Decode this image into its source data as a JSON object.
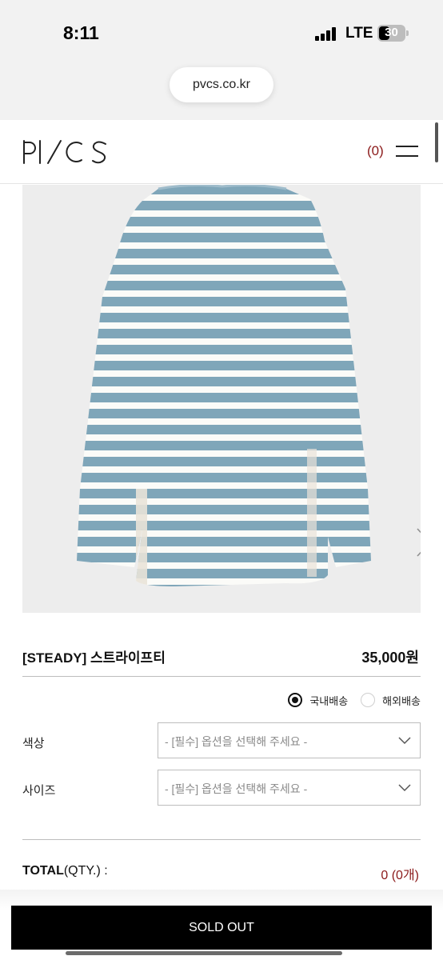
{
  "status_bar": {
    "time": "8:11",
    "network": "LTE",
    "battery": "30"
  },
  "browser": {
    "url": "pvcs.co.kr"
  },
  "header": {
    "logo": "PVCS",
    "cart_count": "(0)"
  },
  "product": {
    "name": "[STEADY] 스트라이프티",
    "price": "35,000원",
    "image_alt": "blue and white striped long sleeve tee"
  },
  "shipping": {
    "domestic": "국내배송",
    "overseas": "해외배송",
    "selected": "domestic"
  },
  "options": [
    {
      "label": "색상",
      "placeholder": "- [필수] 옵션을 선택해 주세요 -"
    },
    {
      "label": "사이즈",
      "placeholder": "- [필수] 옵션을 선택해 주세요 -"
    }
  ],
  "total": {
    "label_bold": "TOTAL",
    "label_rest": "(QTY.) :",
    "value": "0 (0개)"
  },
  "cta": {
    "label": "SOLD OUT"
  },
  "colors": {
    "accent": "#8b1a1a",
    "stripe_blue": "#7fa6b9",
    "button": "#000000"
  },
  "icons": [
    "menu-icon",
    "chevron-right-icon",
    "chevron-down-icon",
    "signal-icon",
    "battery-icon"
  ]
}
